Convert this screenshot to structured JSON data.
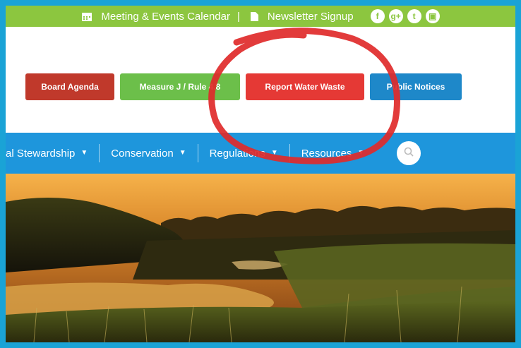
{
  "topbar": {
    "calendar_label": "Meeting & Events Calendar",
    "separator": "|",
    "newsletter_label": "Newsletter Signup",
    "social": [
      "f",
      "g+",
      "t",
      "▣"
    ]
  },
  "quick_links": {
    "board_agenda": "Board Agenda",
    "measure": "Measure J / Rule 4.8",
    "report": "Report Water Waste",
    "notices": "Public Notices"
  },
  "nav": {
    "items": [
      {
        "label": "al Stewardship"
      },
      {
        "label": "Conservation"
      },
      {
        "label": "Regulations"
      },
      {
        "label": "Resources"
      }
    ]
  },
  "colors": {
    "frame": "#1aa3d6",
    "topbar": "#8cc63f",
    "nav": "#1e96dc",
    "annotation": "#e02a2a"
  },
  "icons": {
    "calendar": "calendar-icon",
    "document": "document-icon",
    "search": "search-icon"
  }
}
